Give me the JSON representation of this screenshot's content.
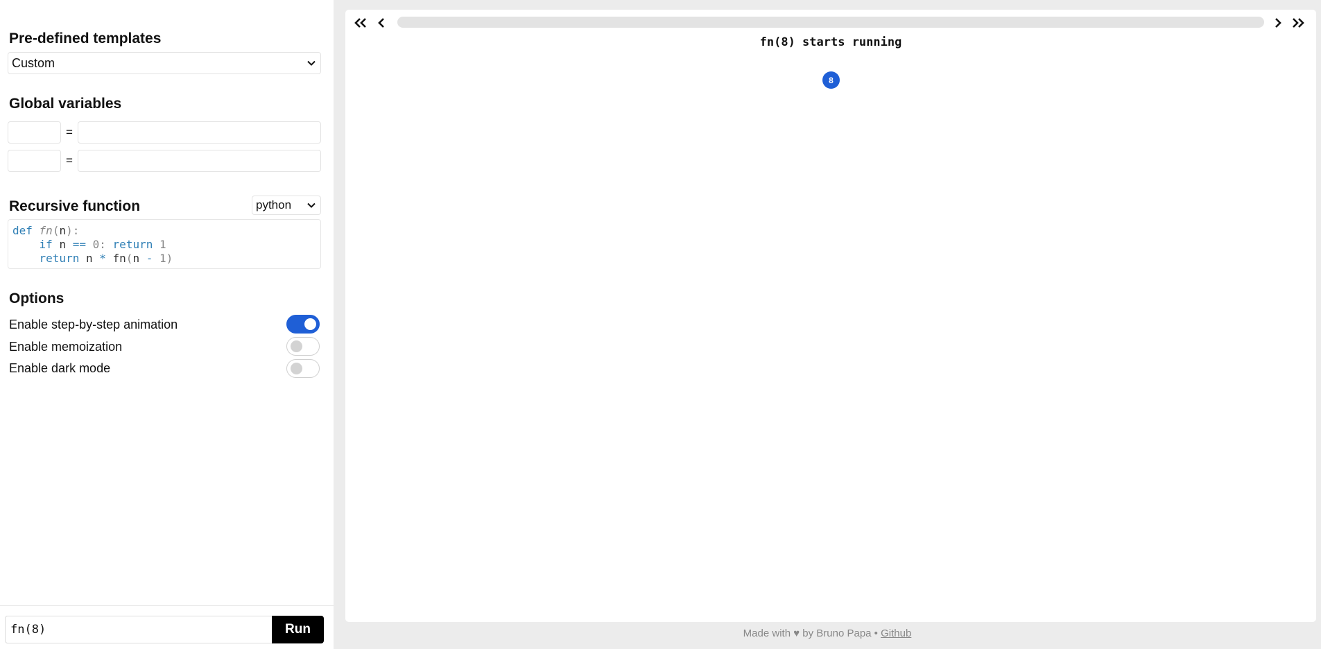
{
  "sidebar": {
    "templates_title": "Pre-defined templates",
    "template_selected": "Custom",
    "globals_title": "Global variables",
    "globals": [
      {
        "name": "",
        "value": ""
      },
      {
        "name": "",
        "value": ""
      }
    ],
    "equals": "=",
    "function_title": "Recursive function",
    "language_selected": "python",
    "code_lines": [
      "def fn(n):",
      "    if n == 0: return 1",
      "    return n * fn(n - 1)"
    ],
    "options_title": "Options",
    "options": [
      {
        "label": "Enable step-by-step animation",
        "enabled": true
      },
      {
        "label": "Enable memoization",
        "enabled": false
      },
      {
        "label": "Enable dark mode",
        "enabled": false
      }
    ],
    "call_value": "fn(8)",
    "run_label": "Run"
  },
  "viewer": {
    "status_text": "fn(8) starts running",
    "progress": 0,
    "nodes": [
      {
        "label": "8"
      }
    ]
  },
  "footer": {
    "text": "Made with ♥ by Bruno Papa • ",
    "link": "Github"
  },
  "colors": {
    "accent": "#1f5fd6",
    "code_keyword": "#2f7fb5",
    "background": "#ececec"
  }
}
